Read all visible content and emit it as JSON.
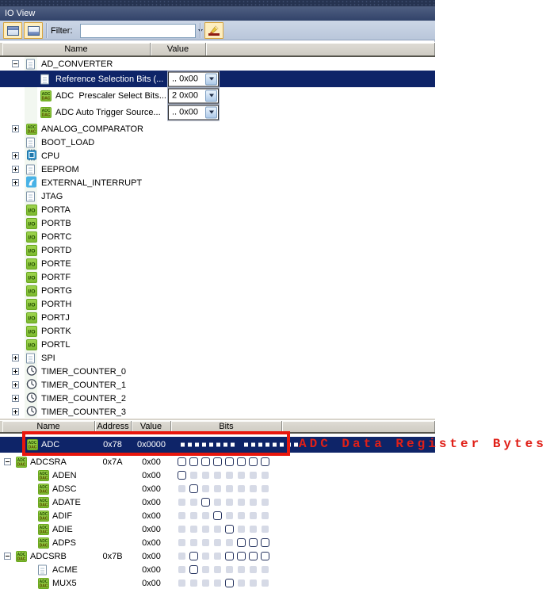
{
  "panel": {
    "title": "IO View"
  },
  "toolbar": {
    "filter_label": "Filter:",
    "filter_value": "",
    "buttons": [
      {
        "name": "pane-top-toggle"
      },
      {
        "name": "pane-bottom-toggle"
      },
      {
        "name": "highlight-changes"
      }
    ]
  },
  "colors": {
    "selection_navy": "#0e2468",
    "annotation_red": "#e8170d",
    "icon_green": "#8dc63f",
    "header_gray": "#d4d1c8",
    "toolbar_blue": "#c3cfe0",
    "title_blue": "#32436a"
  },
  "top_table": {
    "headers": [
      "Name",
      "Value",
      ""
    ]
  },
  "tree": [
    {
      "label": "AD_CONVERTER",
      "icon": "document",
      "expander": "minus",
      "level": 0
    },
    {
      "label": "Reference Selection Bits (...",
      "icon": "document",
      "level": 1,
      "value": ".. 0x00",
      "selected": true
    },
    {
      "label": "ADC  Prescaler Select Bits...",
      "icon": "adc-dac",
      "level": 1,
      "value": "2 0x00"
    },
    {
      "label": "ADC Auto Trigger Source...",
      "icon": "adc-dac",
      "level": 1,
      "value": ".. 0x00"
    },
    {
      "label": "ANALOG_COMPARATOR",
      "icon": "adc-dac",
      "expander": "plus",
      "level": 0,
      "gap": 2
    },
    {
      "label": "BOOT_LOAD",
      "icon": "document",
      "level": 0
    },
    {
      "label": "CPU",
      "icon": "cpu",
      "expander": "plus",
      "level": 0
    },
    {
      "label": "EEPROM",
      "icon": "document",
      "expander": "plus",
      "level": 0
    },
    {
      "label": "EXTERNAL_INTERRUPT",
      "icon": "interrupt",
      "expander": "plus",
      "level": 0
    },
    {
      "label": "JTAG",
      "icon": "document",
      "level": 0
    },
    {
      "label": "PORTA",
      "icon": "io",
      "level": 0
    },
    {
      "label": "PORTB",
      "icon": "io",
      "level": 0
    },
    {
      "label": "PORTC",
      "icon": "io",
      "level": 0
    },
    {
      "label": "PORTD",
      "icon": "io",
      "level": 0
    },
    {
      "label": "PORTE",
      "icon": "io",
      "level": 0
    },
    {
      "label": "PORTF",
      "icon": "io",
      "level": 0
    },
    {
      "label": "PORTG",
      "icon": "io",
      "level": 0
    },
    {
      "label": "PORTH",
      "icon": "io",
      "level": 0
    },
    {
      "label": "PORTJ",
      "icon": "io",
      "level": 0
    },
    {
      "label": "PORTK",
      "icon": "io",
      "level": 0
    },
    {
      "label": "PORTL",
      "icon": "io",
      "level": 0
    },
    {
      "label": "SPI",
      "icon": "document",
      "expander": "plus",
      "level": 0
    },
    {
      "label": "TIMER_COUNTER_0",
      "icon": "timer",
      "expander": "plus",
      "level": 0
    },
    {
      "label": "TIMER_COUNTER_1",
      "icon": "timer",
      "expander": "plus",
      "level": 0
    },
    {
      "label": "TIMER_COUNTER_2",
      "icon": "timer",
      "expander": "plus",
      "level": 0
    },
    {
      "label": "TIMER_COUNTER_3",
      "icon": "timer",
      "expander": "plus",
      "level": 0
    }
  ],
  "bottom_table": {
    "headers": [
      "Name",
      "Address",
      "Value",
      "Bits",
      ""
    ]
  },
  "registers": [
    {
      "name": "ADC",
      "icon": "adc-dac",
      "address": "0x78",
      "value": "0x0000",
      "bits": "dots16",
      "selected": true,
      "level": 0
    },
    {
      "name": "ADCSRA",
      "icon": "adc-dac",
      "expander": "minus",
      "address": "0x7A",
      "value": "0x00",
      "active_bits": [
        0,
        1,
        2,
        3,
        4,
        5,
        6,
        7
      ],
      "level": 0
    },
    {
      "name": "ADEN",
      "icon": "adc-dac",
      "level": 1,
      "value": "0x00",
      "active_bits": [
        0
      ]
    },
    {
      "name": "ADSC",
      "icon": "adc-dac",
      "level": 1,
      "value": "0x00",
      "active_bits": [
        1
      ]
    },
    {
      "name": "ADATE",
      "icon": "adc-dac",
      "level": 1,
      "value": "0x00",
      "active_bits": [
        2
      ]
    },
    {
      "name": "ADIF",
      "icon": "adc-dac",
      "level": 1,
      "value": "0x00",
      "active_bits": [
        3
      ]
    },
    {
      "name": "ADIE",
      "icon": "adc-dac",
      "level": 1,
      "value": "0x00",
      "active_bits": [
        4
      ]
    },
    {
      "name": "ADPS",
      "icon": "adc-dac",
      "level": 1,
      "value": "0x00",
      "active_bits": [
        5,
        6,
        7
      ]
    },
    {
      "name": "ADCSRB",
      "icon": "adc-dac",
      "expander": "minus",
      "address": "0x7B",
      "value": "0x00",
      "active_bits": [
        1,
        4,
        5,
        6,
        7
      ],
      "level": 0
    },
    {
      "name": "ACME",
      "icon": "document",
      "level": 1,
      "value": "0x00",
      "active_bits": [
        1
      ]
    },
    {
      "name": "MUX5",
      "icon": "adc-dac",
      "level": 1,
      "value": "0x00",
      "active_bits": [
        4
      ]
    }
  ],
  "annotation": {
    "text": "ADC Data Register Bytes"
  }
}
